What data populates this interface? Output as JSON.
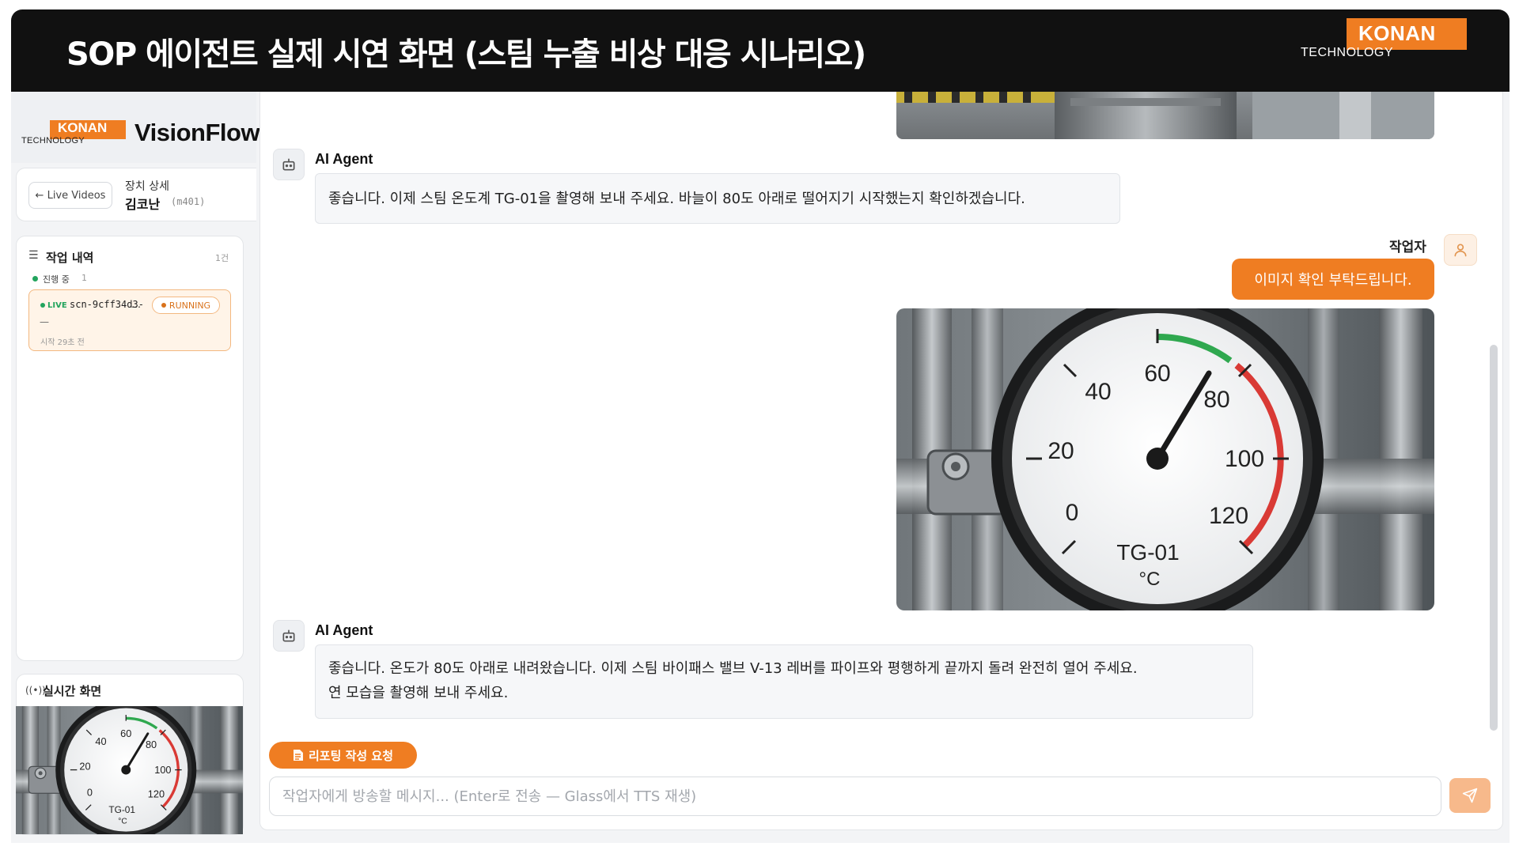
{
  "banner": {
    "title": "SOP 에이전트 실제 시연 화면 (스팀 누출 비상 대응 시나리오)",
    "brand_word": "KONAN",
    "brand_sub": "TECHNOLOGY"
  },
  "sidebar": {
    "logo_word": "KONAN",
    "logo_sub": "TECHNOLOGY",
    "product": "VisionFlow",
    "back_label": "← Live Videos",
    "device_label": "장치 상세",
    "device_name": "김코난",
    "device_id": "(m401)",
    "history": {
      "title": "작업 내역",
      "count": "1건",
      "in_progress_label": "진행 중",
      "in_progress_count": "1",
      "job": {
        "live_label": "LIVE",
        "id": "scn-9cff34d3-",
        "id_ellipsis": "…",
        "status": "RUNNING",
        "dash": "—",
        "started": "시작 29초 전"
      }
    },
    "live": {
      "title": "실시간 화면"
    }
  },
  "gauge": {
    "labels": [
      "0",
      "20",
      "40",
      "60",
      "80",
      "100",
      "120"
    ],
    "name": "TG-01",
    "unit": "°C",
    "reading": 80
  },
  "chat": {
    "messages": [
      {
        "sender": "AI Agent",
        "lines": [
          "좋습니다. 이제 스팀 온도계 TG-01을 촬영해 보내 주세요. 바늘이 80도 아래로 떨어지기 시작했는지 확인하겠습니다."
        ]
      },
      {
        "sender": "작업자",
        "text": "이미지 확인 부탁드립니다."
      },
      {
        "sender": "AI Agent",
        "lines": [
          "좋습니다. 온도가 80도 아래로 내려왔습니다. 이제 스팀 바이패스 밸브 V-13 레버를 파이프와 평행하게 끝까지 돌려 완전히 열어 주세요.",
          "연 모습을 촬영해 보내 주세요."
        ]
      }
    ],
    "report_button": "리포팅 작성 요청",
    "input_placeholder": "작업자에게 방송할 메시지... (Enter로 전송 — Glass에서 TTS 재생)"
  },
  "colors": {
    "accent": "#ef7d22",
    "banner": "#111111",
    "live_green": "#22a45d"
  },
  "icons": {
    "agent": "robot-icon",
    "user": "person-icon",
    "send": "paper-plane-icon",
    "report": "document-icon",
    "list": "list-icon",
    "broadcast": "broadcast-icon"
  }
}
